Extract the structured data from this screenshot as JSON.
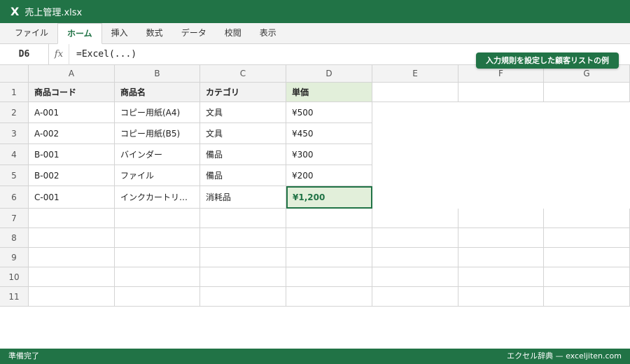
{
  "window": {
    "app_icon": "excel-x-icon",
    "logo_letter": "X",
    "title": "売上管理.xlsx",
    "accent": "#217346"
  },
  "ribbon": {
    "tabs": [
      "ファイル",
      "ホーム",
      "挿入",
      "数式",
      "データ",
      "校閲",
      "表示"
    ],
    "active_tab": "ホーム"
  },
  "formula_bar": {
    "name_box": "D6",
    "fx_label": "fx",
    "formula": "=Excel(...)"
  },
  "callout": {
    "text": "入力規則を設定した顧客リストの例"
  },
  "sheet": {
    "columns": [
      "A",
      "B",
      "C",
      "D",
      "E",
      "F",
      "G"
    ],
    "rows": [
      "1",
      "2",
      "3",
      "4",
      "5",
      "6",
      "7",
      "8",
      "9",
      "10",
      "11"
    ],
    "selected_cell": "D6",
    "table": [
      [
        "商品コード",
        "商品名",
        "カテゴリ",
        "単価"
      ],
      [
        "A-001",
        "コピー用紙(A4)",
        "文具",
        "¥500"
      ],
      [
        "A-002",
        "コピー用紙(B5)",
        "文具",
        "¥450"
      ],
      [
        "B-001",
        "バインダー",
        "備品",
        "¥300"
      ],
      [
        "B-002",
        "ファイル",
        "備品",
        "¥200"
      ],
      [
        "C-001",
        "インクカートリ…",
        "消耗品",
        "¥1,200"
      ]
    ]
  },
  "status_bar": {
    "left": "準備完了",
    "right": "エクセル辞典 — exceljiten.com"
  }
}
